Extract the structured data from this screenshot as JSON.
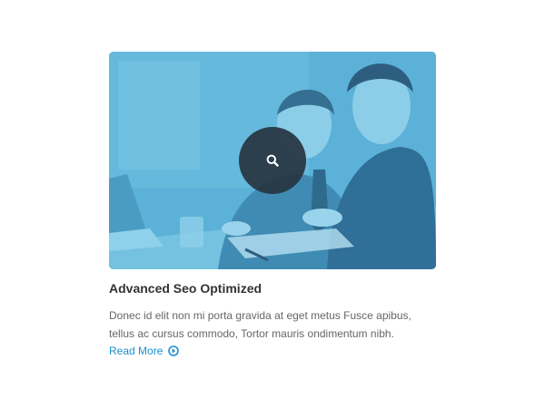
{
  "card": {
    "title": "Advanced Seo Optimized",
    "description": "Donec id elit non mi porta gravida at eget metus Fusce apibus, tellus ac cursus commodo, Tortor mauris ondimentum nibh.",
    "read_more_label": "Read More",
    "image_alt": "business meeting photo",
    "overlay_icon": "search-icon",
    "read_more_icon": "circle-arrow-right-icon"
  },
  "colors": {
    "overlay_tint": "#5bb1d7",
    "overlay_button": "#263440",
    "title": "#333333",
    "text": "#666666",
    "link": "#1c8fd0"
  }
}
